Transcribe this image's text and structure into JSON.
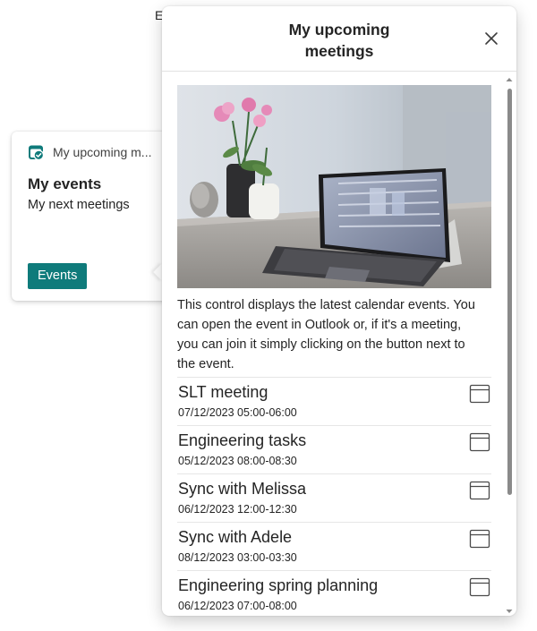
{
  "background": {
    "partial_text": "E"
  },
  "card": {
    "app_icon": "calendar-check-icon",
    "app_name": "My upcoming m...",
    "title": "My events",
    "subtitle": "My next meetings",
    "button_label": "Events",
    "accent_color": "#0f7b7b"
  },
  "panel": {
    "title": "My upcoming meetings",
    "close_icon": "close-icon",
    "hero_image": "photo of a laptop showing a calendar on a desk next to a flower vase",
    "description": "This control displays the latest calendar events. You can open the event in Outlook or, if it's a meeting, you can join it simply clicking on the button next to the event.",
    "events": [
      {
        "title": "SLT meeting",
        "time": "07/12/2023 05:00-06:00",
        "icon": "calendar-icon"
      },
      {
        "title": "Engineering tasks",
        "time": "05/12/2023 08:00-08:30",
        "icon": "calendar-icon"
      },
      {
        "title": "Sync with Melissa",
        "time": "06/12/2023 12:00-12:30",
        "icon": "calendar-icon"
      },
      {
        "title": "Sync with Adele",
        "time": "08/12/2023 03:00-03:30",
        "icon": "calendar-icon"
      },
      {
        "title": "Engineering spring planning",
        "time": "06/12/2023 07:00-08:00",
        "icon": "calendar-icon"
      }
    ]
  }
}
